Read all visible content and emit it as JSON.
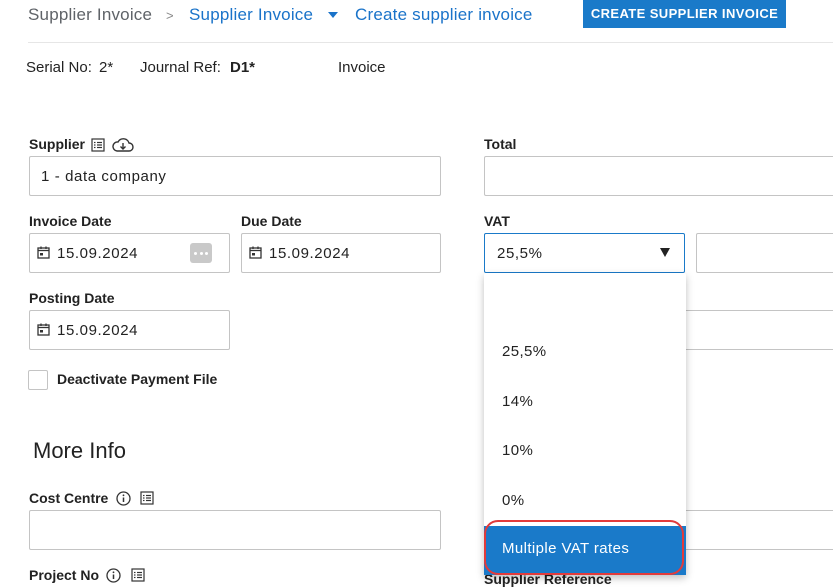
{
  "breadcrumb": {
    "home": "Supplier Invoice",
    "separator": ">",
    "parent": "Supplier Invoice",
    "current": "Create supplier invoice"
  },
  "toolbar": {
    "create_label": "CREATE SUPPLIER INVOICE"
  },
  "meta": {
    "serial_label": "Serial No:",
    "serial_value": "2*",
    "journal_label": "Journal Ref:",
    "journal_value": "D1*",
    "doc_type": "Invoice"
  },
  "form": {
    "supplier_label": "Supplier",
    "supplier_value": "1 - data company",
    "total_label": "Total",
    "total_value": "",
    "invoice_date_label": "Invoice Date",
    "invoice_date_value": "15.09.2024",
    "due_date_label": "Due Date",
    "due_date_value": "15.09.2024",
    "vat_label": "VAT",
    "vat_value": "25,5%",
    "posting_date_label": "Posting Date",
    "posting_date_value": "15.09.2024",
    "deactivate_label": "Deactivate Payment File"
  },
  "more_info": {
    "title": "More Info",
    "cost_centre_label": "Cost Centre",
    "project_no_label": "Project No",
    "supplier_reference_label": "Supplier Reference"
  },
  "vat_dropdown": {
    "options": [
      "",
      "25,5%",
      "14%",
      "10%",
      "0%",
      "Multiple VAT rates"
    ],
    "selected": "Multiple VAT rates"
  },
  "colors": {
    "accent": "#1a7ac9",
    "highlight_ring": "#e23b3b"
  }
}
